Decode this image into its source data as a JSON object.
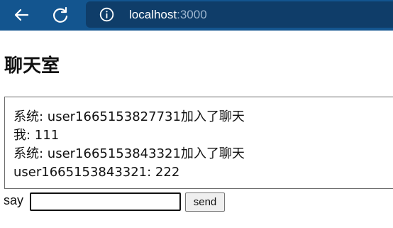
{
  "browser": {
    "url_host": "localhost",
    "url_port": ":3000",
    "icons": {
      "back": "arrow-left-icon",
      "reload": "reload-icon",
      "info": "info-icon"
    },
    "colors": {
      "toolbar": "#13558f",
      "address_bar": "#0f3d69"
    }
  },
  "page": {
    "title": "聊天室"
  },
  "chat": {
    "messages": [
      "系统: user1665153827731加入了聊天",
      "我: 111",
      "系统: user1665153843321加入了聊天",
      "user1665153843321: 222"
    ]
  },
  "composer": {
    "label": "say",
    "input_value": "",
    "send_label": "send"
  }
}
